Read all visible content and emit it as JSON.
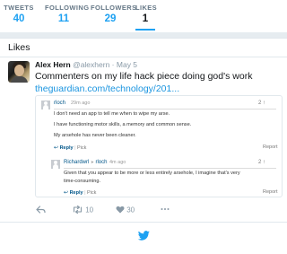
{
  "stats": [
    {
      "label": "TWEETS",
      "value": "40"
    },
    {
      "label": "FOLLOWING",
      "value": "11"
    },
    {
      "label": "FOLLOWERS",
      "value": "29"
    },
    {
      "label": "LIKES",
      "value": "1",
      "active": true
    }
  ],
  "panel": {
    "title": "Likes"
  },
  "tweet": {
    "name": "Alex Hern",
    "handle": "@alexhern",
    "separator": "·",
    "date": "May 5",
    "text": "Commenters on my life hack piece doing god's work",
    "link": "theguardian.com/technology/201..."
  },
  "comment": {
    "user": "rloch",
    "time": "29m ago",
    "count": "2",
    "lines": [
      "I don't need an app to tell me when to wipe my arse.",
      "I have functioning motor skills, a memory and common sense.",
      "My arsehole has never been cleaner."
    ],
    "reply_label": "Reply",
    "pick_label": "Pick",
    "report_label": "Report"
  },
  "reply": {
    "user": "Richardwrl",
    "arrow": "➤",
    "to": "rloch",
    "time": "4m ago",
    "count": "2",
    "lines": [
      "Given that you appear to be more or less entirely arsehole, I imagine that's very",
      "time-consuming."
    ],
    "reply_label": "Reply",
    "pick_label": "Pick",
    "report_label": "Report"
  },
  "actions": {
    "retweets": "10",
    "likes": "30"
  },
  "colors": {
    "accent": "#1da1f2",
    "link": "#1b95e0",
    "guardian_blue": "#005689"
  }
}
